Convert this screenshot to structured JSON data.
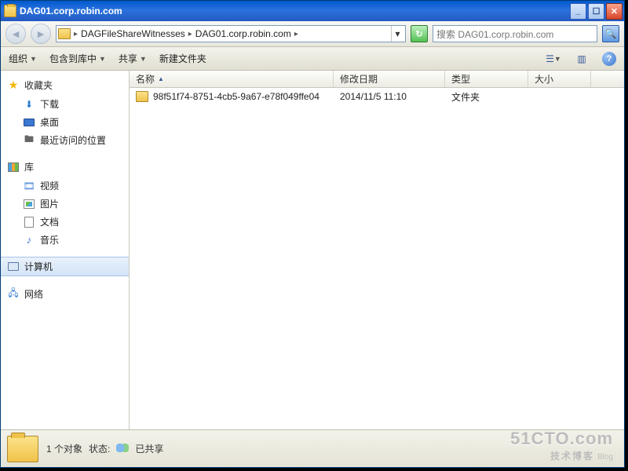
{
  "window": {
    "title": "DAG01.corp.robin.com"
  },
  "nav": {
    "crumbs": [
      "DAGFileShareWitnesses",
      "DAG01.corp.robin.com"
    ],
    "search_placeholder": "搜索 DAG01.corp.robin.com"
  },
  "toolbar": {
    "organize": "组织",
    "include": "包含到库中",
    "share": "共享",
    "newfolder": "新建文件夹"
  },
  "sidebar": {
    "favorites": {
      "label": "收藏夹",
      "items": [
        {
          "label": "下载",
          "icon": "download-icon"
        },
        {
          "label": "桌面",
          "icon": "desktop-icon"
        },
        {
          "label": "最近访问的位置",
          "icon": "recent-icon"
        }
      ]
    },
    "libraries": {
      "label": "库",
      "items": [
        {
          "label": "视频",
          "icon": "video-icon"
        },
        {
          "label": "图片",
          "icon": "picture-icon"
        },
        {
          "label": "文档",
          "icon": "document-icon"
        },
        {
          "label": "音乐",
          "icon": "music-icon"
        }
      ]
    },
    "computer": {
      "label": "计算机"
    },
    "network": {
      "label": "网络"
    }
  },
  "columns": {
    "name": "名称",
    "modified": "修改日期",
    "type": "类型",
    "size": "大小"
  },
  "files": [
    {
      "name": "98f51f74-8751-4cb5-9a67-e78f049ffe04",
      "modified": "2014/11/5 11:10",
      "type": "文件夹",
      "size": ""
    }
  ],
  "status": {
    "count_label": "1 个对象",
    "state_label": "状态:",
    "shared_label": "已共享"
  },
  "watermark": {
    "line1": "51CTO.com",
    "line2": "技术博客",
    "tag": "Blog"
  },
  "colwidths": {
    "name": 260,
    "modified": 142,
    "type": 106,
    "size": 80
  }
}
